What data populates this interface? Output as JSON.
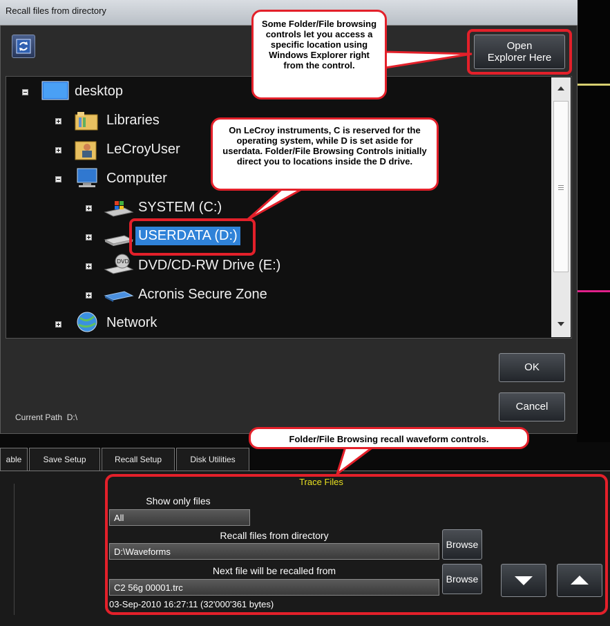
{
  "dialog": {
    "title": "Recall files from directory",
    "open_explorer_label_1": "Open",
    "open_explorer_label_2": "Explorer Here",
    "ok_label": "OK",
    "cancel_label": "Cancel",
    "current_path_label": "Current Path",
    "current_path_value": "D:\\"
  },
  "tree": {
    "desktop": "desktop",
    "libraries": "Libraries",
    "lecroyuser": "LeCroyUser",
    "computer": "Computer",
    "system": "SYSTEM (C:)",
    "userdata": "USERDATA (D:)",
    "dvd": "DVD/CD-RW Drive (E:)",
    "acronis": "Acronis Secure Zone",
    "network": "Network"
  },
  "tabs": [
    "able",
    "Save Setup",
    "Recall Setup",
    "Disk Utilities"
  ],
  "trace_files": {
    "title": "Trace Files",
    "show_only_label": "Show only files",
    "show_only_value": "All",
    "recall_dir_label": "Recall files from directory",
    "recall_dir_value": "D:\\Waveforms",
    "browse_label": "Browse",
    "next_file_label": "Next file will be recalled from",
    "next_file_value": "C2 56g 00001.trc",
    "file_info": "03-Sep-2010 16:27:11 (32'000'361 bytes)"
  },
  "callouts": {
    "explorer": "Some Folder/File browsing controls let you access a specific location using Windows Explorer right from the control.",
    "drives": "On LeCroy instruments, C is reserved for the operating system, while D is set aside for userdata. Folder/File Browsing Controls initially direct you to locations inside the D drive.",
    "recall": "Folder/File Browsing recall waveform controls."
  },
  "colors": {
    "highlight": "#e3202a",
    "selection": "#2f82d8",
    "trace_title": "#e8e020"
  }
}
